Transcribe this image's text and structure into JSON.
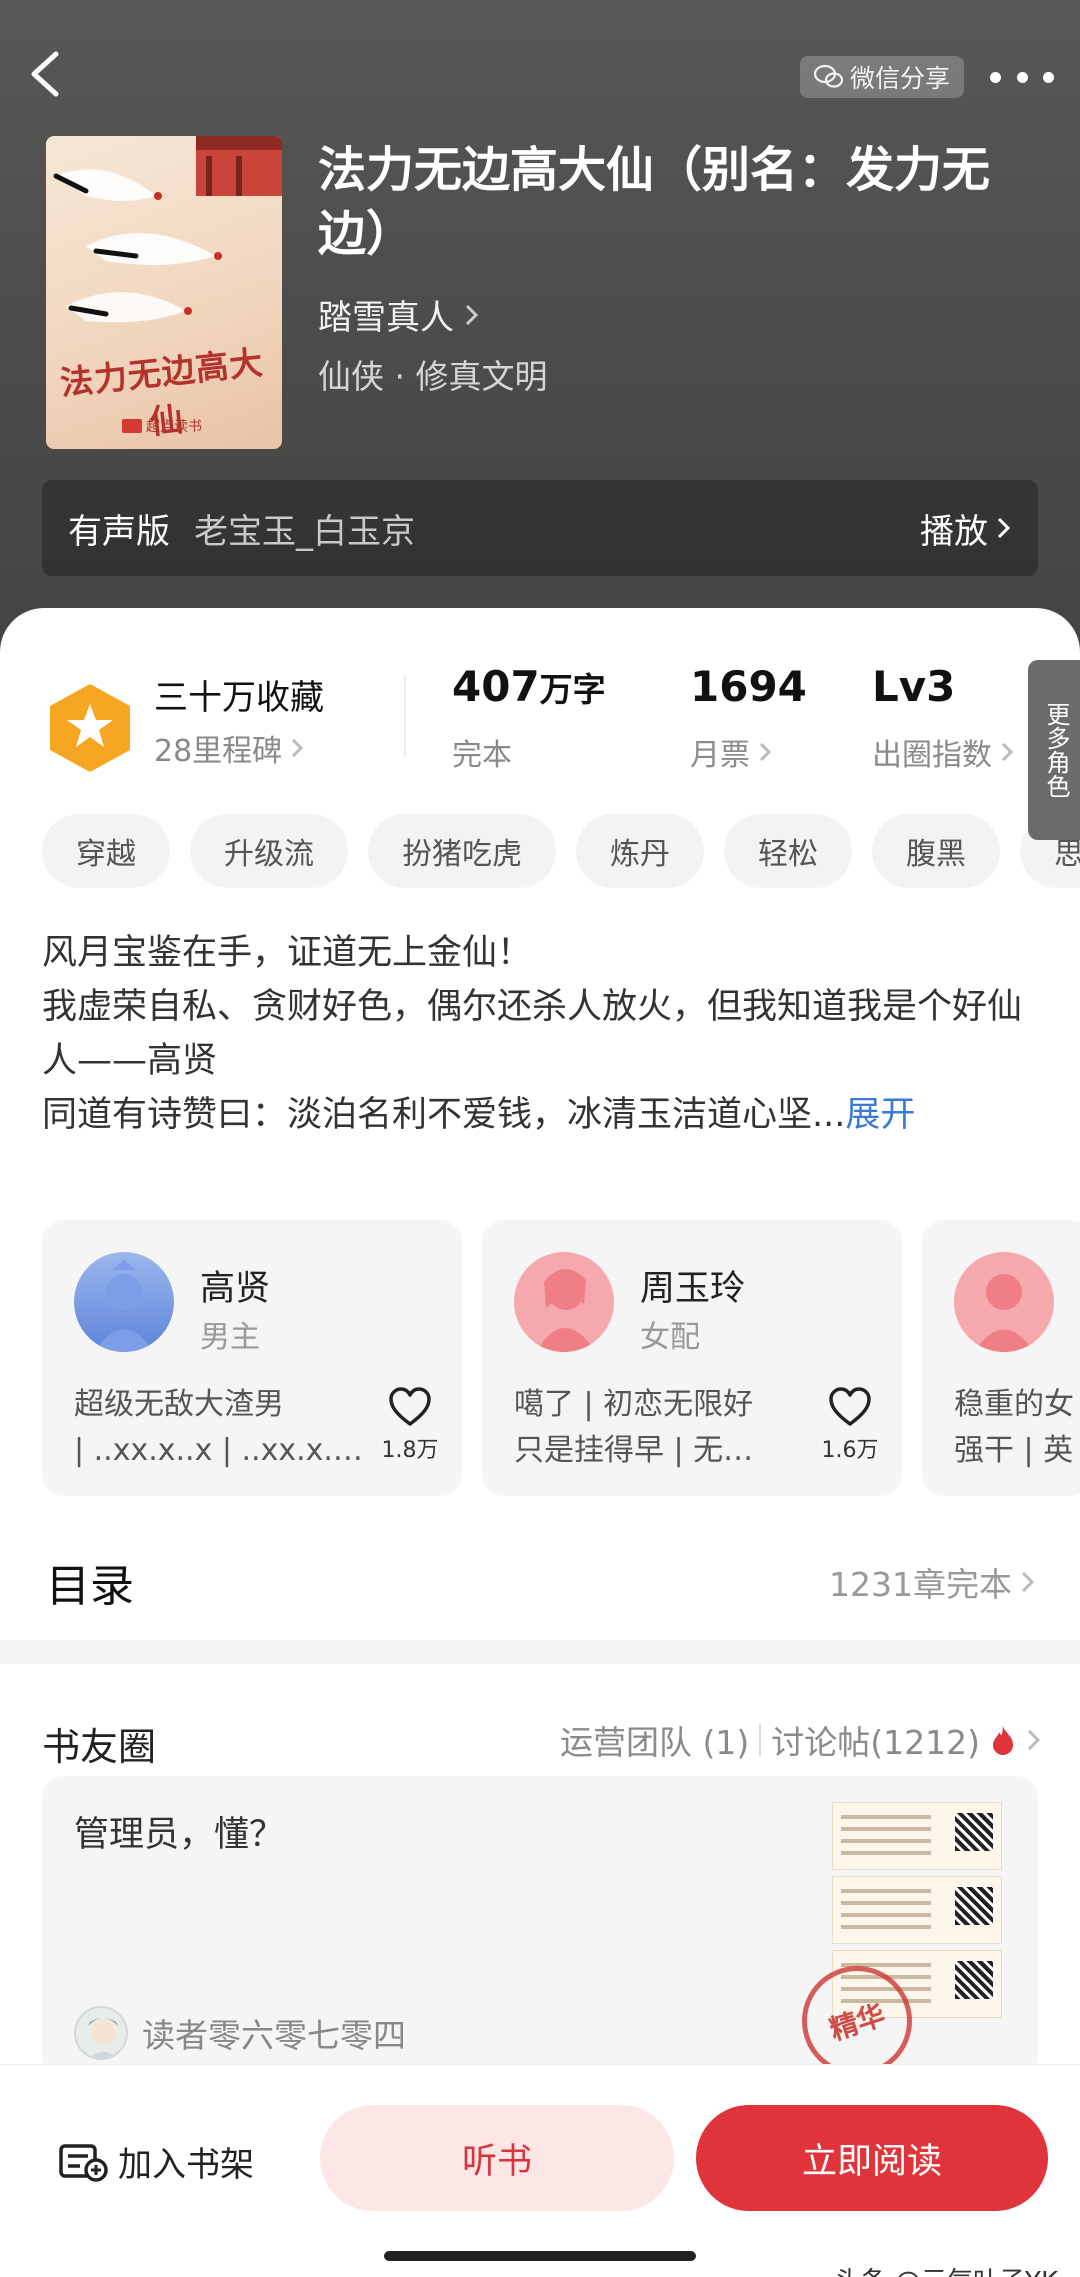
{
  "header": {
    "share_label": "微信分享",
    "book_title": "法力无边高大仙（别名：发力无边）",
    "author": "踏雪真人",
    "genre": "仙侠 · 修真文明",
    "cover_title": "法力无边高大仙",
    "cover_publisher": "超点读书"
  },
  "audio": {
    "label": "有声版",
    "narrator": "老宝玉_白玉京",
    "play_label": "播放"
  },
  "stats": {
    "collections": "三十万收藏",
    "milestones": "28里程碑",
    "word_count": "407",
    "word_unit": "万字",
    "status": "完本",
    "monthly_votes": "1694",
    "monthly_votes_label": "月票",
    "level": "Lv3",
    "level_label": "出圈指数"
  },
  "tags": [
    "穿越",
    "升级流",
    "扮猪吃虎",
    "炼丹",
    "轻松",
    "腹黑",
    "思"
  ],
  "intro": {
    "line1": "风月宝鉴在手，证道无上金仙！",
    "line2": "我虚荣自私、贪财好色，偶尔还杀人放火，但我知道我是个好仙人——高贤",
    "line3": "同道有诗赞曰：淡泊名利不爱钱，冰清玉洁道心坚...",
    "expand": "展开"
  },
  "roles": [
    {
      "name": "高贤",
      "type": "男主",
      "desc1": "超级无敌大渣男",
      "desc2": "| ..xx.x..x | ..xx.x.…",
      "likes": "1.8万"
    },
    {
      "name": "周玉玲",
      "type": "女配",
      "desc1": "噶了 | 初恋无限好",
      "desc2": "只是挂得早 | 无…",
      "likes": "1.6万"
    },
    {
      "desc1": "稳重的女",
      "desc2": "强干 | 英"
    }
  ],
  "more_roles": "更多角色",
  "toc": {
    "title": "目录",
    "info": "1231章完本"
  },
  "circle": {
    "title": "书友圈",
    "team": "运营团队 (1)",
    "discuss": "讨论帖(1212)",
    "post_text": "管理员，懂？",
    "post_user": "读者零六零七零四",
    "stamp": "精华"
  },
  "bottom": {
    "shelf": "加入书架",
    "listen": "听书",
    "read": "立即阅读",
    "watermark": "头条 @元气叶子YK"
  },
  "colors": {
    "accent_red": "#e0343b",
    "listen_bg": "#fde6e6",
    "link_blue": "#3a7bd5",
    "badge_orange": "#f6a623"
  }
}
